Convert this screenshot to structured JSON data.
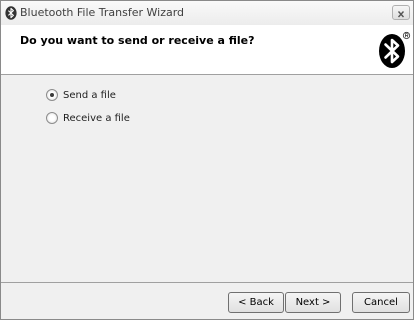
{
  "window": {
    "title": "Bluetooth File Transfer Wizard"
  },
  "header": {
    "question": "Do you want to send or receive a file?",
    "logo_icon": "bluetooth-logo-icon"
  },
  "options": {
    "selected": "send",
    "send_label": "Send a file",
    "receive_label": "Receive a file"
  },
  "buttons": {
    "back_label": "< Back",
    "next_label": "Next >",
    "cancel_label": "Cancel"
  },
  "colors": {
    "logo_background": "#000000",
    "logo_rune": "#ffffff",
    "dialog_background": "#f0f0f0",
    "header_background": "#ffffff"
  }
}
